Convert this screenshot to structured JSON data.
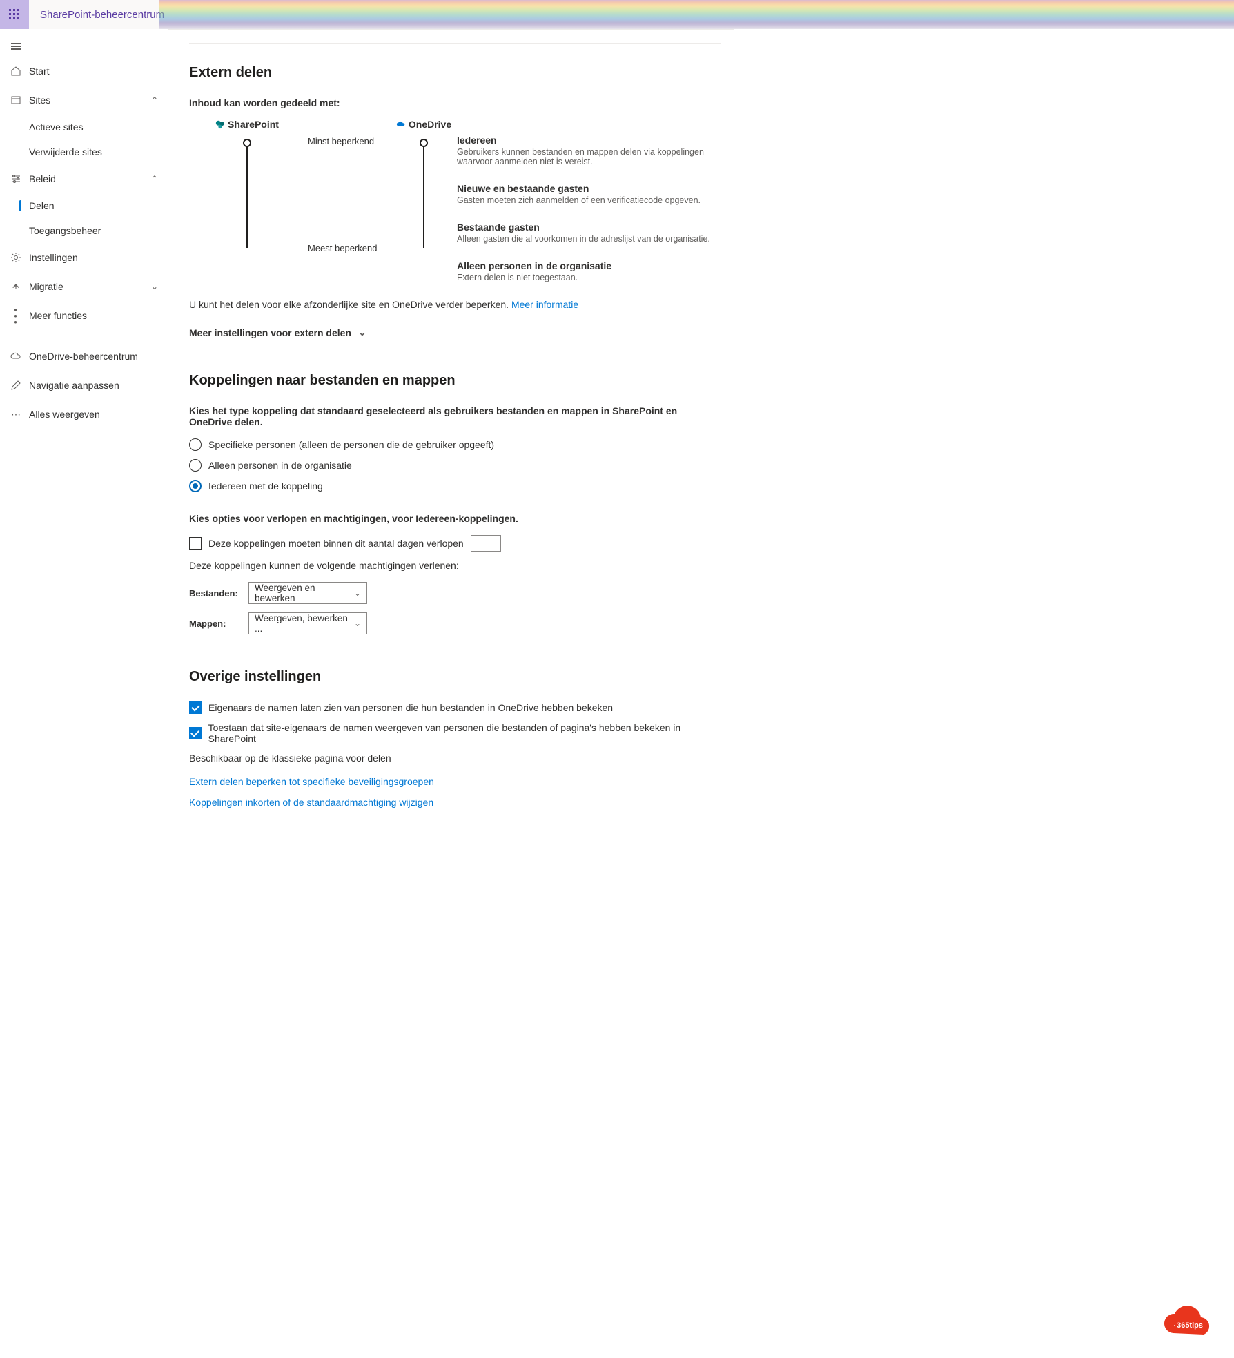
{
  "header": {
    "app_title": "SharePoint-beheercentrum"
  },
  "sidebar": {
    "home": "Start",
    "sites": "Sites",
    "sites_active": "Actieve sites",
    "sites_deleted": "Verwijderde sites",
    "policy": "Beleid",
    "policy_sharing": "Delen",
    "policy_access": "Toegangsbeheer",
    "settings": "Instellingen",
    "migration": "Migratie",
    "more_features": "Meer functies",
    "onedrive_admin": "OneDrive-beheercentrum",
    "customize_nav": "Navigatie aanpassen",
    "show_all": "Alles weergeven"
  },
  "ext_sharing": {
    "heading": "Extern delen",
    "sub": "Inhoud kan worden gedeeld met:",
    "col_sp": "SharePoint",
    "col_od": "OneDrive",
    "least": "Minst beperkend",
    "most": "Meest beperkend",
    "levels": [
      {
        "title": "Iedereen",
        "sub": "Gebruikers kunnen bestanden en mappen delen via koppelingen waarvoor aanmelden niet is vereist."
      },
      {
        "title": "Nieuwe en bestaande gasten",
        "sub": "Gasten moeten zich aanmelden of een verificatiecode opgeven."
      },
      {
        "title": "Bestaande gasten",
        "sub": "Alleen gasten die al voorkomen in de adreslijst van de organisatie."
      },
      {
        "title": "Alleen personen in de organisatie",
        "sub": "Extern delen is niet toegestaan."
      }
    ],
    "note_prefix": "U kunt het delen voor elke afzonderlijke site en OneDrive verder beperken.",
    "note_link": "Meer informatie",
    "more": "Meer instellingen voor extern delen"
  },
  "links_section": {
    "heading": "Koppelingen naar bestanden en mappen",
    "desc": "Kies het type koppeling dat standaard geselecteerd als gebruikers bestanden en mappen in SharePoint en OneDrive delen.",
    "opt_specific": "Specifieke personen (alleen de personen die de gebruiker opgeeft)",
    "opt_org": "Alleen personen in de organisatie",
    "opt_anyone": "Iedereen met de koppeling",
    "expire_heading": "Kies opties voor verlopen en machtigingen, voor Iedereen-koppelingen.",
    "expire_check": "Deze koppelingen moeten binnen dit aantal dagen verlopen",
    "perm_intro": "Deze koppelingen kunnen de volgende machtigingen verlenen:",
    "files_label": "Bestanden:",
    "files_value": "Weergeven en bewerken",
    "folders_label": "Mappen:",
    "folders_value": "Weergeven, bewerken ..."
  },
  "other": {
    "heading": "Overige instellingen",
    "opt1": "Eigenaars de namen laten zien van personen die hun bestanden in OneDrive hebben bekeken",
    "opt2": "Toestaan dat site-eigenaars de namen weergeven van personen die bestanden of pagina's hebben bekeken in SharePoint",
    "classic": "Beschikbaar op de klassieke pagina voor delen",
    "link1": "Extern delen beperken tot specifieke beveiligingsgroepen",
    "link2": "Koppelingen inkorten of de standaardmachtiging wijzigen"
  },
  "badge": {
    "text": "365tips"
  }
}
